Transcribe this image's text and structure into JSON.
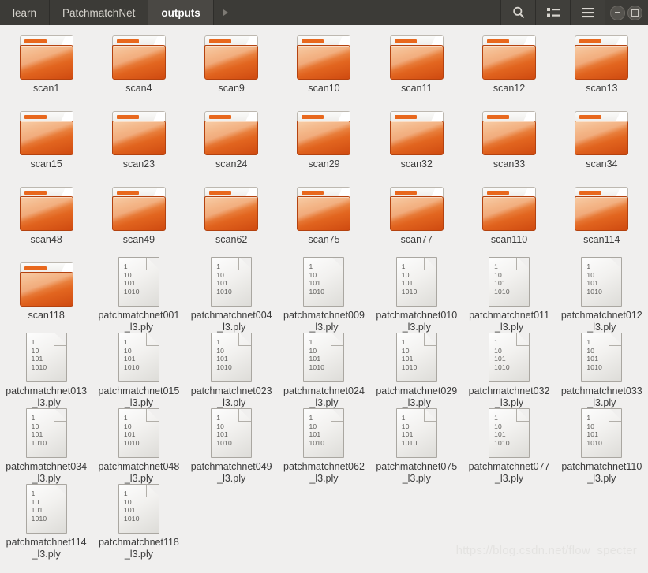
{
  "window": {
    "background_color": "#f0efee",
    "titlebar_color": "#3c3b37",
    "accent_color": "#e8681d"
  },
  "titlebar": {
    "breadcrumbs": [
      {
        "label": "learn",
        "active": false
      },
      {
        "label": "PatchmatchNet",
        "active": false
      },
      {
        "label": "outputs",
        "active": true
      }
    ],
    "forward_arrow_icon": "chevron-right-icon",
    "buttons": [
      {
        "name": "search-button",
        "icon": "search-icon"
      },
      {
        "name": "view-options-button",
        "icon": "list-view-icon"
      },
      {
        "name": "menu-button",
        "icon": "hamburger-menu-icon"
      }
    ],
    "window_controls": [
      {
        "name": "minimize-button",
        "icon": "minimize-icon"
      },
      {
        "name": "maximize-button",
        "icon": "maximize-icon"
      }
    ]
  },
  "file_icon": {
    "lines": [
      "1",
      "10",
      "101",
      "1010"
    ]
  },
  "items": [
    {
      "name": "scan1",
      "type": "folder"
    },
    {
      "name": "scan4",
      "type": "folder"
    },
    {
      "name": "scan9",
      "type": "folder"
    },
    {
      "name": "scan10",
      "type": "folder"
    },
    {
      "name": "scan11",
      "type": "folder"
    },
    {
      "name": "scan12",
      "type": "folder"
    },
    {
      "name": "scan13",
      "type": "folder"
    },
    {
      "name": "scan15",
      "type": "folder"
    },
    {
      "name": "scan23",
      "type": "folder"
    },
    {
      "name": "scan24",
      "type": "folder"
    },
    {
      "name": "scan29",
      "type": "folder"
    },
    {
      "name": "scan32",
      "type": "folder"
    },
    {
      "name": "scan33",
      "type": "folder"
    },
    {
      "name": "scan34",
      "type": "folder"
    },
    {
      "name": "scan48",
      "type": "folder"
    },
    {
      "name": "scan49",
      "type": "folder"
    },
    {
      "name": "scan62",
      "type": "folder"
    },
    {
      "name": "scan75",
      "type": "folder"
    },
    {
      "name": "scan77",
      "type": "folder"
    },
    {
      "name": "scan110",
      "type": "folder"
    },
    {
      "name": "scan114",
      "type": "folder"
    },
    {
      "name": "scan118",
      "type": "folder"
    },
    {
      "name": "patchmatchnet001_l3.ply",
      "type": "file"
    },
    {
      "name": "patchmatchnet004_l3.ply",
      "type": "file"
    },
    {
      "name": "patchmatchnet009_l3.ply",
      "type": "file"
    },
    {
      "name": "patchmatchnet010_l3.ply",
      "type": "file"
    },
    {
      "name": "patchmatchnet011_l3.ply",
      "type": "file"
    },
    {
      "name": "patchmatchnet012_l3.ply",
      "type": "file"
    },
    {
      "name": "patchmatchnet013_l3.ply",
      "type": "file"
    },
    {
      "name": "patchmatchnet015_l3.ply",
      "type": "file"
    },
    {
      "name": "patchmatchnet023_l3.ply",
      "type": "file"
    },
    {
      "name": "patchmatchnet024_l3.ply",
      "type": "file"
    },
    {
      "name": "patchmatchnet029_l3.ply",
      "type": "file"
    },
    {
      "name": "patchmatchnet032_l3.ply",
      "type": "file"
    },
    {
      "name": "patchmatchnet033_l3.ply",
      "type": "file"
    },
    {
      "name": "patchmatchnet034_l3.ply",
      "type": "file"
    },
    {
      "name": "patchmatchnet048_l3.ply",
      "type": "file"
    },
    {
      "name": "patchmatchnet049_l3.ply",
      "type": "file"
    },
    {
      "name": "patchmatchnet062_l3.ply",
      "type": "file"
    },
    {
      "name": "patchmatchnet075_l3.ply",
      "type": "file"
    },
    {
      "name": "patchmatchnet077_l3.ply",
      "type": "file"
    },
    {
      "name": "patchmatchnet110_l3.ply",
      "type": "file"
    },
    {
      "name": "patchmatchnet114_l3.ply",
      "type": "file"
    },
    {
      "name": "patchmatchnet118_l3.ply",
      "type": "file"
    }
  ],
  "watermark": {
    "text": "https://blog.csdn.net/flow_specter"
  }
}
